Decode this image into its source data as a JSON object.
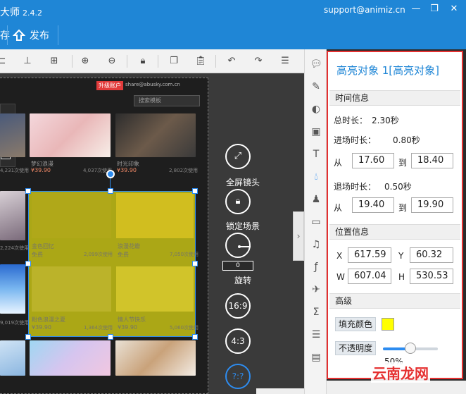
{
  "titlebar": {
    "title": "大师",
    "version": "2.4.2",
    "support": "support@animiz.cn",
    "min": "—",
    "max": "❐",
    "close": "✕"
  },
  "ribbon": {
    "item_partial": "存",
    "publish": "发布"
  },
  "stage": {
    "badge": "升级账户",
    "mail": "share@abusky.com.cn",
    "search_placeholder": "搜索模板",
    "thumbs": [
      {
        "cap": "",
        "price": "",
        "used": "4,231次使用"
      },
      {
        "cap": "梦幻浪漫",
        "price": "¥39.90",
        "used": "4,037次使用"
      },
      {
        "cap": "时光印象",
        "price": "¥39.90",
        "used": "2,802次使用"
      },
      {
        "cap": "",
        "price": "",
        "used": "2,224次使用"
      },
      {
        "cap": "",
        "price": "",
        "used": "9,019次使用"
      }
    ],
    "hl_captions": [
      {
        "cap": "金色回忆",
        "price": "免费",
        "used": "2,099次使用"
      },
      {
        "cap": "浪漫花瓣",
        "price": "免费",
        "used": "7,050次使用"
      },
      {
        "cap": "粉色浪漫之夏",
        "price": "¥39.90",
        "used": "1,364次使用"
      },
      {
        "cap": "情人节快乐",
        "price": "¥39.90",
        "used": "5,060次使用"
      }
    ]
  },
  "actions": {
    "fullscreen": "全屏镜头",
    "lock": "锁定场景",
    "rotate_value": "0",
    "rotate": "旋转",
    "r169": "16:9",
    "r43": "4:3",
    "custom": "?:?"
  },
  "panel": {
    "title": "高亮对象 1[高亮对象]",
    "time_section": "时间信息",
    "total_label": "总时长：",
    "total_value": "2.30秒",
    "enter_label": "进场时长：",
    "enter_value": "0.80秒",
    "from": "从",
    "to": "到",
    "enter_from": "17.60",
    "enter_to": "18.40",
    "exit_label": "退场时长：",
    "exit_value": "0.50秒",
    "exit_from": "19.40",
    "exit_to": "19.90",
    "pos_section": "位置信息",
    "x_label": "X",
    "x_value": "617.59",
    "y_label": "Y",
    "y_value": "60.32",
    "w_label": "W",
    "w_value": "607.04",
    "h_label": "H",
    "h_value": "530.53",
    "adv_section": "高级",
    "fill_label": "填充颜色",
    "fill_color": "#ffff00",
    "opacity_label": "不透明度",
    "opacity_value": "50%",
    "opacity_fraction": 0.5
  },
  "watermark": "云南龙网"
}
